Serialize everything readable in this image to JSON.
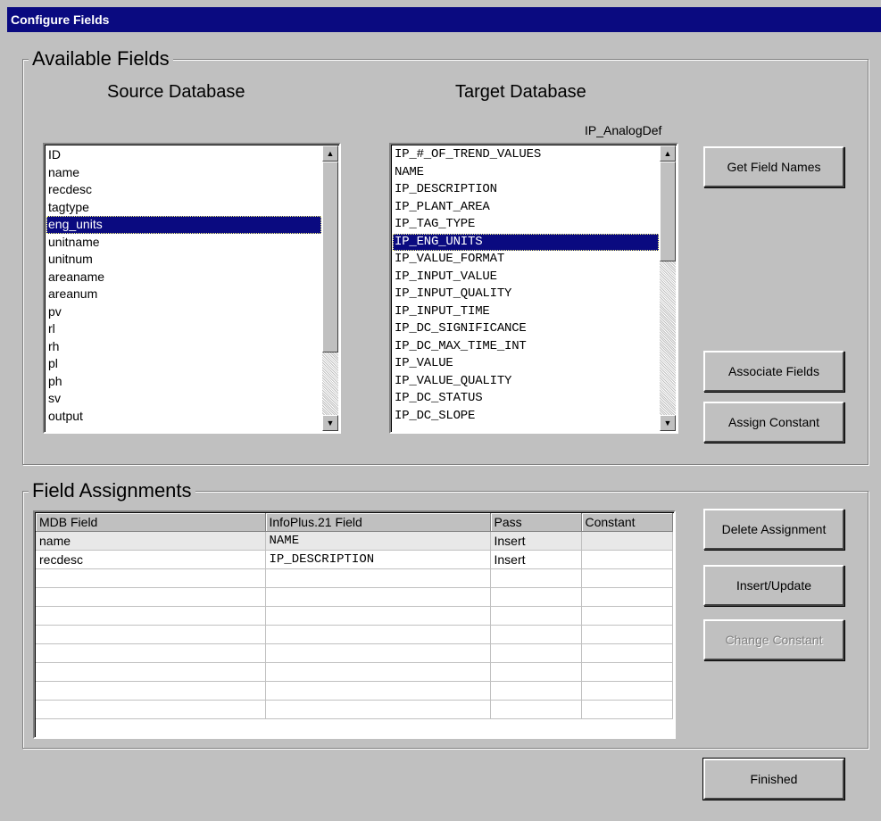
{
  "window": {
    "title": "Configure Fields"
  },
  "available_fields": {
    "group_label": "Available Fields",
    "source_heading": "Source Database",
    "target_heading": "Target Database",
    "target_table": "IP_AnalogDef",
    "source_items": [
      "ID",
      "name",
      "recdesc",
      "tagtype",
      "eng_units",
      "unitname",
      "unitnum",
      "areaname",
      "areanum",
      "pv",
      "rl",
      "rh",
      "pl",
      "ph",
      "sv",
      "output"
    ],
    "source_selected": "eng_units",
    "target_items": [
      "IP_#_OF_TREND_VALUES",
      "NAME",
      "IP_DESCRIPTION",
      "IP_PLANT_AREA",
      "IP_TAG_TYPE",
      "IP_ENG_UNITS",
      "IP_VALUE_FORMAT",
      "IP_INPUT_VALUE",
      "IP_INPUT_QUALITY",
      "IP_INPUT_TIME",
      "IP_DC_SIGNIFICANCE",
      "IP_DC_MAX_TIME_INT",
      "IP_VALUE",
      "IP_VALUE_QUALITY",
      "IP_DC_STATUS",
      "IP_DC_SLOPE"
    ],
    "target_selected": "IP_ENG_UNITS"
  },
  "buttons": {
    "get_field_names": "Get Field Names",
    "associate_fields": "Associate Fields",
    "assign_constant": "Assign Constant",
    "delete_assignment": "Delete Assignment",
    "insert_update": "Insert/Update",
    "change_constant": "Change Constant",
    "finished": "Finished"
  },
  "field_assignments": {
    "group_label": "Field Assignments",
    "columns": [
      "MDB Field",
      "InfoPlus.21 Field",
      "Pass",
      "Constant"
    ],
    "rows": [
      [
        "name",
        "NAME",
        "Insert",
        ""
      ],
      [
        "recdesc",
        "IP_DESCRIPTION",
        "Insert",
        ""
      ]
    ]
  }
}
